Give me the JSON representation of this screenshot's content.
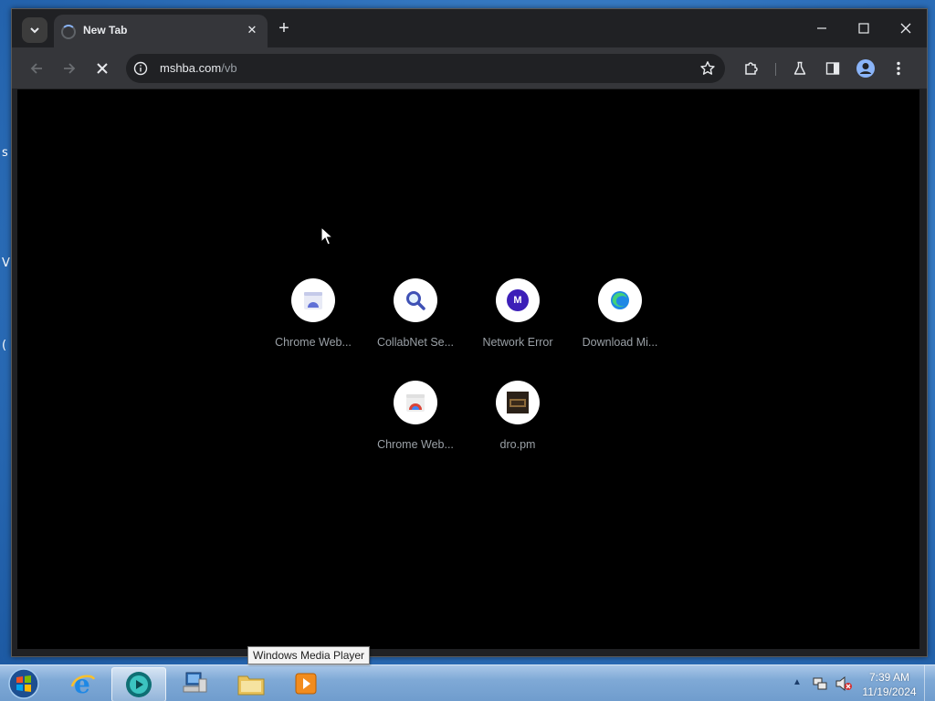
{
  "browser": {
    "tab": {
      "title": "New Tab"
    },
    "address": {
      "host": "mshba.com",
      "path": "/vb"
    },
    "shortcuts": [
      {
        "label": "Chrome Web...",
        "icon": "chrome-web-store-icon"
      },
      {
        "label": "CollabNet Se...",
        "icon": "magnifier-icon"
      },
      {
        "label": "Network Error",
        "icon": "letter-m-icon",
        "glyph": "M"
      },
      {
        "label": "Download Mi...",
        "icon": "edge-icon"
      },
      {
        "label": "Chrome Web...",
        "icon": "chrome-web-store-icon"
      },
      {
        "label": "dro.pm",
        "icon": "dro-pm-favicon"
      }
    ]
  },
  "taskbar": {
    "tooltip": "Windows Media Player",
    "clock": {
      "time": "7:39 AM",
      "date": "11/19/2024"
    },
    "apps": [
      "internet-explorer",
      "media-player",
      "network-computer",
      "file-explorer",
      "media-center"
    ]
  },
  "colors": {
    "content_bg": "#000000",
    "frame": "#202124",
    "toolbar": "#35363a",
    "accent": "#8ab4f8"
  }
}
